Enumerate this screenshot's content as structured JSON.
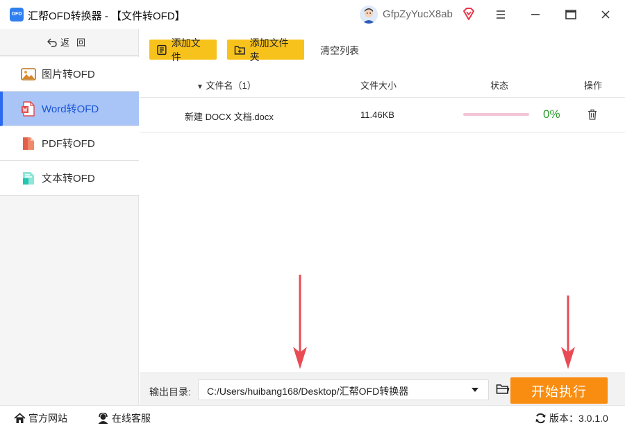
{
  "app": {
    "logo_text": "OFD",
    "title": "汇帮OFD转换器 - 【文件转OFD】",
    "user_name": "GfpZyYucX8ab"
  },
  "sidebar": {
    "back_label": "返回",
    "items": [
      {
        "label": "图片转OFD",
        "icon": "image-icon",
        "active": false
      },
      {
        "label": "Word转OFD",
        "icon": "word-icon",
        "active": true
      },
      {
        "label": "PDF转OFD",
        "icon": "pdf-icon",
        "active": false
      },
      {
        "label": "文本转OFD",
        "icon": "text-file-icon",
        "active": false
      }
    ]
  },
  "toolbar": {
    "add_file_label": "添加文件",
    "add_folder_label": "添加文件夹",
    "clear_label": "清空列表"
  },
  "table": {
    "headers": {
      "name": "文件名（1）",
      "size": "文件大小",
      "status": "状态",
      "action": "操作"
    },
    "rows": [
      {
        "name": "新建 DOCX 文档.docx",
        "size": "11.46KB",
        "progress": 0,
        "progress_label": "0%"
      }
    ]
  },
  "output": {
    "label": "输出目录:",
    "path": "C:/Users/huibang168/Desktop/汇帮OFD转换器",
    "start_label": "开始执行"
  },
  "statusbar": {
    "site_label": "官方网站",
    "service_label": "在线客服",
    "version_label": "版本：3.0.1.0"
  },
  "colors": {
    "accent": "#2a6af0",
    "toolbar_button": "#f8c21c",
    "start_button": "#f98d12",
    "arrow": "#e94b55",
    "progress_track": "#f3c4d6",
    "percent_text": "#2f9a2f"
  }
}
